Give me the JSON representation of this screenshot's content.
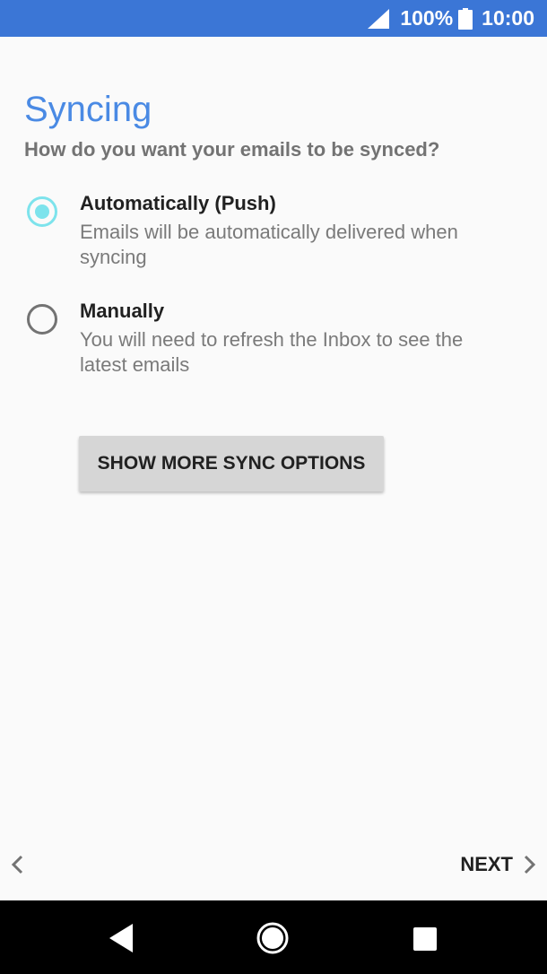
{
  "status_bar": {
    "battery_percent": "100%",
    "time": "10:00",
    "color": "#3b76d6"
  },
  "screen": {
    "title": "Syncing",
    "subtitle": "How do you want your emails to be synced?"
  },
  "options": [
    {
      "label": "Automatically (Push)",
      "description": "Emails will be automatically delivered when syncing",
      "selected": true
    },
    {
      "label": "Manually",
      "description": "You will need to refresh the Inbox to see the latest emails",
      "selected": false
    }
  ],
  "buttons": {
    "more_sync_options": "SHOW MORE SYNC OPTIONS",
    "next": "NEXT"
  },
  "icons": {
    "signal": "signal-icon",
    "battery": "battery-icon",
    "back": "chevron-left-icon",
    "next": "chevron-right-icon",
    "nav_back": "triangle-back-icon",
    "nav_home": "circle-home-icon",
    "nav_recent": "square-recent-icon"
  },
  "colors": {
    "accent": "#4a8ae4",
    "radio_selected": "#7de3ec"
  }
}
